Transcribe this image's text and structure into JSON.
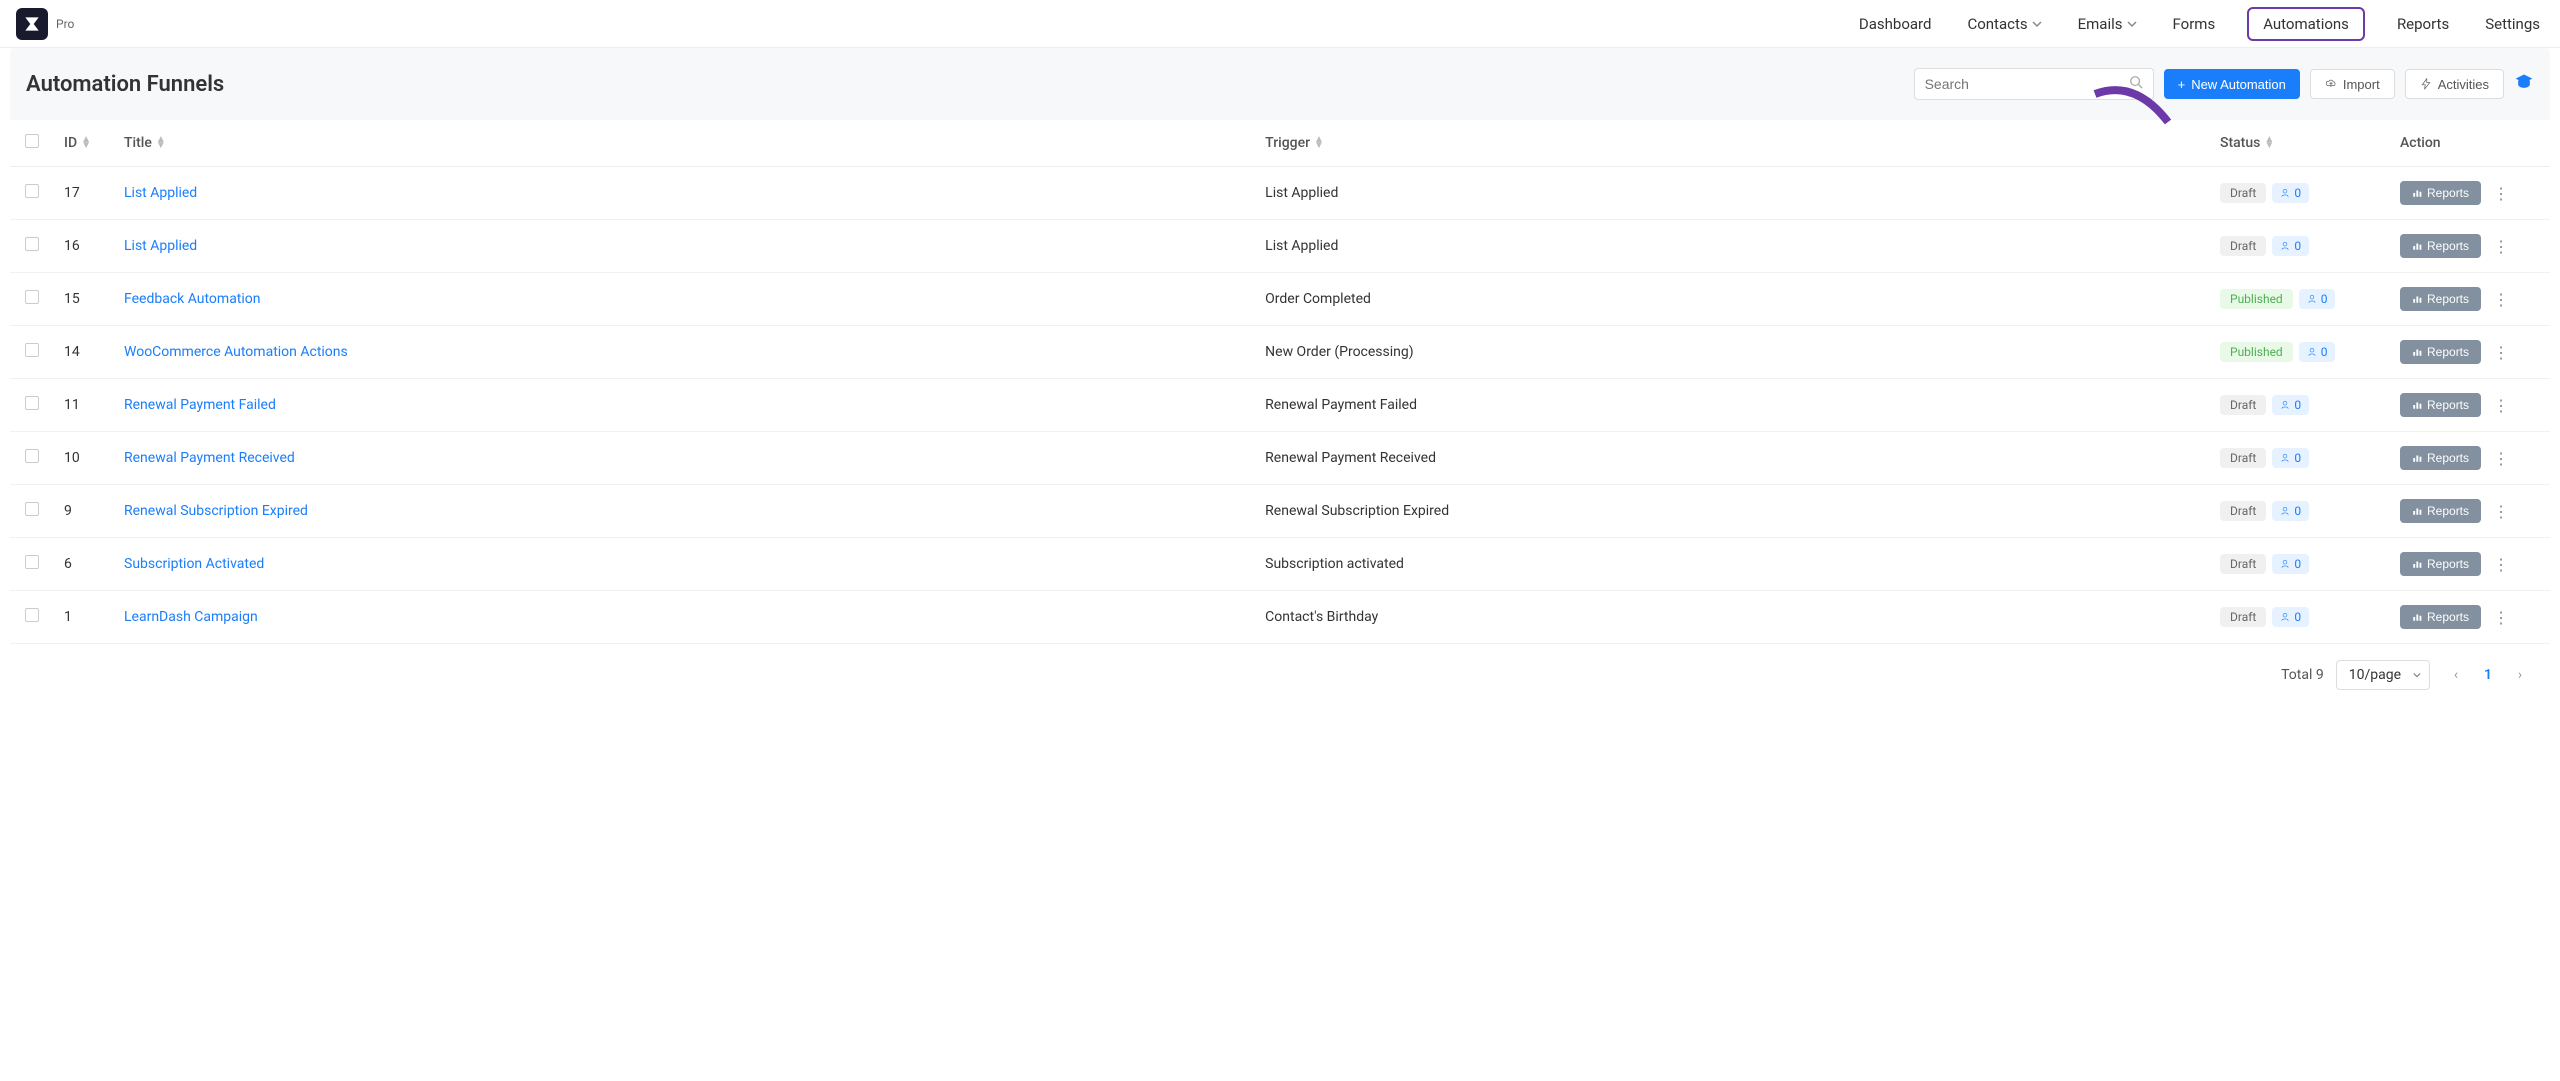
{
  "header": {
    "pro_label": "Pro",
    "nav": [
      {
        "label": "Dashboard",
        "dropdown": false
      },
      {
        "label": "Contacts",
        "dropdown": true
      },
      {
        "label": "Emails",
        "dropdown": true
      },
      {
        "label": "Forms",
        "dropdown": false
      },
      {
        "label": "Automations",
        "dropdown": false,
        "active": true
      },
      {
        "label": "Reports",
        "dropdown": false
      },
      {
        "label": "Settings",
        "dropdown": false
      }
    ]
  },
  "page": {
    "title": "Automation Funnels",
    "search_placeholder": "Search",
    "new_btn": "New Automation",
    "import_btn": "Import",
    "activities_btn": "Activities"
  },
  "table": {
    "columns": {
      "id": "ID",
      "title": "Title",
      "trigger": "Trigger",
      "status": "Status",
      "action": "Action"
    },
    "rows": [
      {
        "id": "17",
        "title": "List Applied",
        "trigger": "List Applied",
        "status": "Draft",
        "count": "0"
      },
      {
        "id": "16",
        "title": "List Applied",
        "trigger": "List Applied",
        "status": "Draft",
        "count": "0"
      },
      {
        "id": "15",
        "title": "Feedback Automation",
        "trigger": "Order Completed",
        "status": "Published",
        "count": "0"
      },
      {
        "id": "14",
        "title": "WooCommerce Automation Actions",
        "trigger": "New Order (Processing)",
        "status": "Published",
        "count": "0"
      },
      {
        "id": "11",
        "title": "Renewal Payment Failed",
        "trigger": "Renewal Payment Failed",
        "status": "Draft",
        "count": "0"
      },
      {
        "id": "10",
        "title": "Renewal Payment Received",
        "trigger": "Renewal Payment Received",
        "status": "Draft",
        "count": "0"
      },
      {
        "id": "9",
        "title": "Renewal Subscription Expired",
        "trigger": "Renewal Subscription Expired",
        "status": "Draft",
        "count": "0"
      },
      {
        "id": "6",
        "title": "Subscription Activated",
        "trigger": "Subscription activated",
        "status": "Draft",
        "count": "0"
      },
      {
        "id": "1",
        "title": "LearnDash Campaign",
        "trigger": "Contact's Birthday",
        "status": "Draft",
        "count": "0"
      }
    ],
    "reports_label": "Reports"
  },
  "footer": {
    "total": "Total 9",
    "page_size": "10/page",
    "current_page": "1"
  }
}
